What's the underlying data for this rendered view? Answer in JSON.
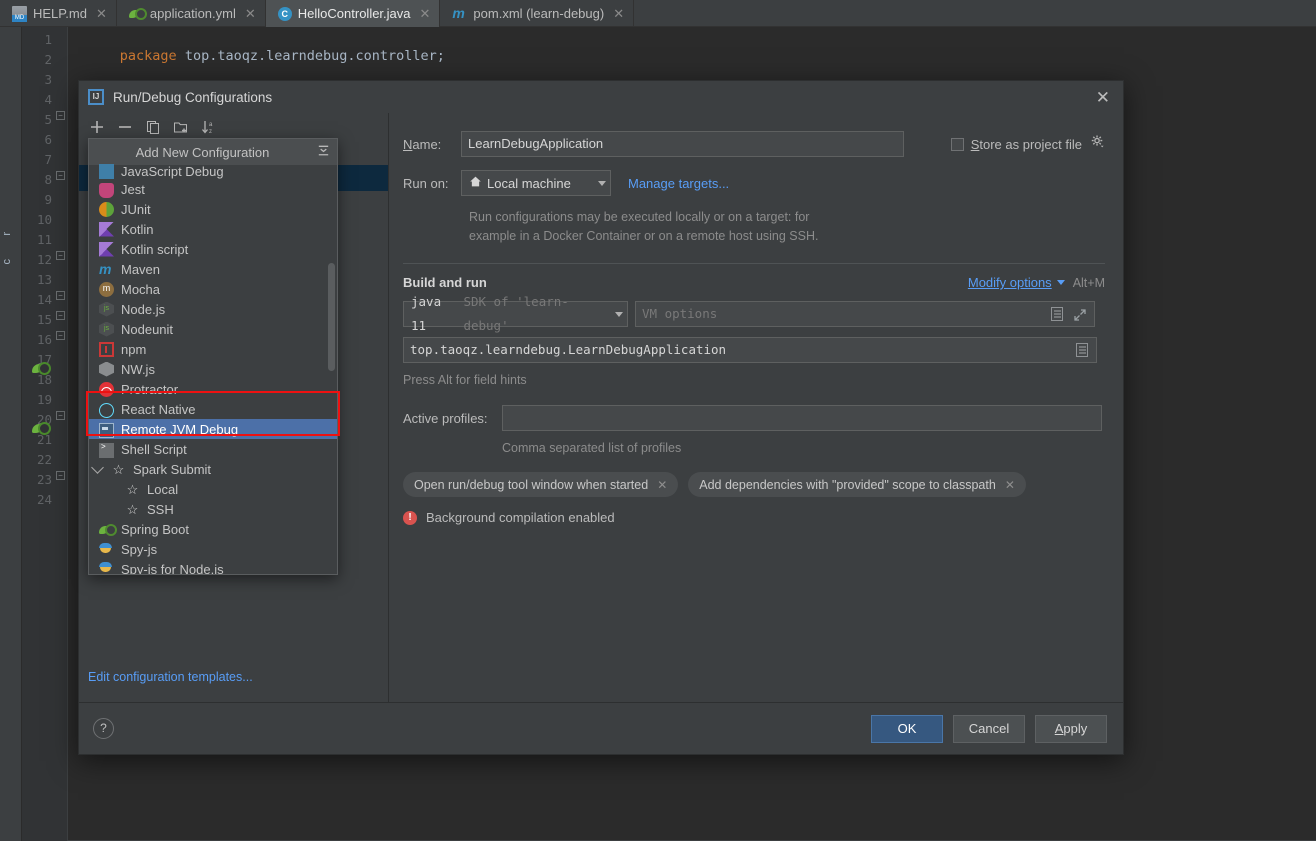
{
  "editor": {
    "tabs": [
      {
        "label": "HELP.md",
        "icon": "markdown-icon",
        "active": false
      },
      {
        "label": "application.yml",
        "icon": "spring-yaml-icon",
        "active": false
      },
      {
        "label": "HelloController.java",
        "icon": "java-class-icon",
        "active": true
      },
      {
        "label": "pom.xml (learn-debug)",
        "icon": "maven-icon",
        "active": false
      }
    ],
    "line_numbers": [
      "1",
      "2",
      "3",
      "4",
      "5",
      "6",
      "7",
      "8",
      "9",
      "10",
      "11",
      "12",
      "13",
      "14",
      "15",
      "16",
      "17",
      "18",
      "19",
      "20",
      "21",
      "22",
      "23",
      "24"
    ],
    "code": {
      "line1_keyword": "package",
      "line1_rest": " top.taoqz.learndebug.controller;"
    },
    "tool_strip_labels": [
      "r",
      "c"
    ]
  },
  "dialog": {
    "title": "Run/Debug Configurations",
    "close_label": "✕",
    "logo_text": "IJ",
    "toolbar": [
      {
        "name": "add-configuration-button",
        "glyph": "plus-icon"
      },
      {
        "name": "remove-configuration-button",
        "glyph": "minus-icon"
      },
      {
        "name": "copy-configuration-button",
        "glyph": "copy-icon"
      },
      {
        "name": "new-folder-button",
        "glyph": "folder-add-icon"
      },
      {
        "name": "sort-configurations-button",
        "glyph": "sort-az-icon"
      }
    ],
    "edit_templates_link": "Edit configuration templates...",
    "footer": {
      "help_label": "?",
      "ok_label": "OK",
      "cancel_label": "Cancel",
      "apply_label": "Apply",
      "apply_mnemonic": "A"
    }
  },
  "popup": {
    "title": "Add New Configuration",
    "items": [
      {
        "label": "JavaScript Debug",
        "icon": "javascript-debug-icon",
        "indent": 0,
        "selected": false,
        "clipped_top": true
      },
      {
        "label": "Jest",
        "icon": "jest-icon",
        "indent": 0,
        "selected": false
      },
      {
        "label": "JUnit",
        "icon": "junit-icon",
        "indent": 0,
        "selected": false
      },
      {
        "label": "Kotlin",
        "icon": "kotlin-icon",
        "indent": 0,
        "selected": false
      },
      {
        "label": "Kotlin script",
        "icon": "kotlin-icon",
        "indent": 0,
        "selected": false
      },
      {
        "label": "Maven",
        "icon": "maven-icon",
        "indent": 0,
        "selected": false
      },
      {
        "label": "Mocha",
        "icon": "mocha-icon",
        "indent": 0,
        "selected": false
      },
      {
        "label": "Node.js",
        "icon": "nodejs-icon",
        "indent": 0,
        "selected": false
      },
      {
        "label": "Nodeunit",
        "icon": "nodeunit-icon",
        "indent": 0,
        "selected": false
      },
      {
        "label": "npm",
        "icon": "npm-icon",
        "indent": 0,
        "selected": false
      },
      {
        "label": "NW.js",
        "icon": "nwjs-icon",
        "indent": 0,
        "selected": false
      },
      {
        "label": "Protractor",
        "icon": "protractor-icon",
        "indent": 0,
        "selected": false
      },
      {
        "label": "React Native",
        "icon": "react-native-icon",
        "indent": 0,
        "selected": false
      },
      {
        "label": "Remote JVM Debug",
        "icon": "remote-jvm-debug-icon",
        "indent": 0,
        "selected": true
      },
      {
        "label": "Shell Script",
        "icon": "shell-script-icon",
        "indent": 0,
        "selected": false
      },
      {
        "label": "Spark Submit",
        "icon": "spark-icon",
        "indent": 0,
        "selected": false,
        "expandable": true
      },
      {
        "label": "Local",
        "icon": "spark-icon",
        "indent": 1,
        "selected": false
      },
      {
        "label": "SSH",
        "icon": "spark-icon",
        "indent": 1,
        "selected": false
      },
      {
        "label": "Spring Boot",
        "icon": "spring-boot-icon",
        "indent": 0,
        "selected": false
      },
      {
        "label": "Spy-js",
        "icon": "spyjs-icon",
        "indent": 0,
        "selected": false
      },
      {
        "label": "Spy-js for Node.js",
        "icon": "spyjs-node-icon",
        "indent": 0,
        "selected": false
      }
    ],
    "highlight_color": "#ee1111",
    "selection_color": "#4c70a8"
  },
  "form": {
    "name_label": "Name:",
    "name_mnemonic": "N",
    "name_value": "LearnDebugApplication",
    "store_as_project_file_label": "Store as project file",
    "store_as_project_file_mnemonic": "S",
    "store_as_project_file_checked": false,
    "run_on_label": "Run on:",
    "run_on_value": "Local machine",
    "manage_targets_link": "Manage targets...",
    "run_on_hint_line1": "Run configurations may be executed locally or on a target: for",
    "run_on_hint_line2": "example in a Docker Container or on a remote host using SSH.",
    "build_and_run_title": "Build and run",
    "modify_options_link": "Modify options",
    "modify_options_shortcut": "Alt+M",
    "jdk_name": "java 11",
    "jdk_detail": "SDK of 'learn-debug'",
    "vm_options_placeholder": "VM options",
    "main_class_value": "top.taoqz.learndebug.LearnDebugApplication",
    "field_hints_text": "Press Alt for field hints",
    "active_profiles_label": "Active profiles:",
    "active_profiles_value": "",
    "active_profiles_hint": "Comma separated list of profiles",
    "chips": [
      {
        "label": "Open run/debug tool window when started",
        "remove": "✕"
      },
      {
        "label": "Add dependencies with \"provided\" scope to classpath",
        "remove": "✕"
      }
    ],
    "warning_text": "Background compilation enabled"
  },
  "colors": {
    "accent_blue": "#589df6",
    "primary_button": "#365880",
    "selection": "#4c70a8",
    "warning_red": "#d9534f",
    "highlight_red": "#ee1111",
    "dialog_bg": "#3c3f41",
    "editor_bg": "#2b2b2b"
  }
}
